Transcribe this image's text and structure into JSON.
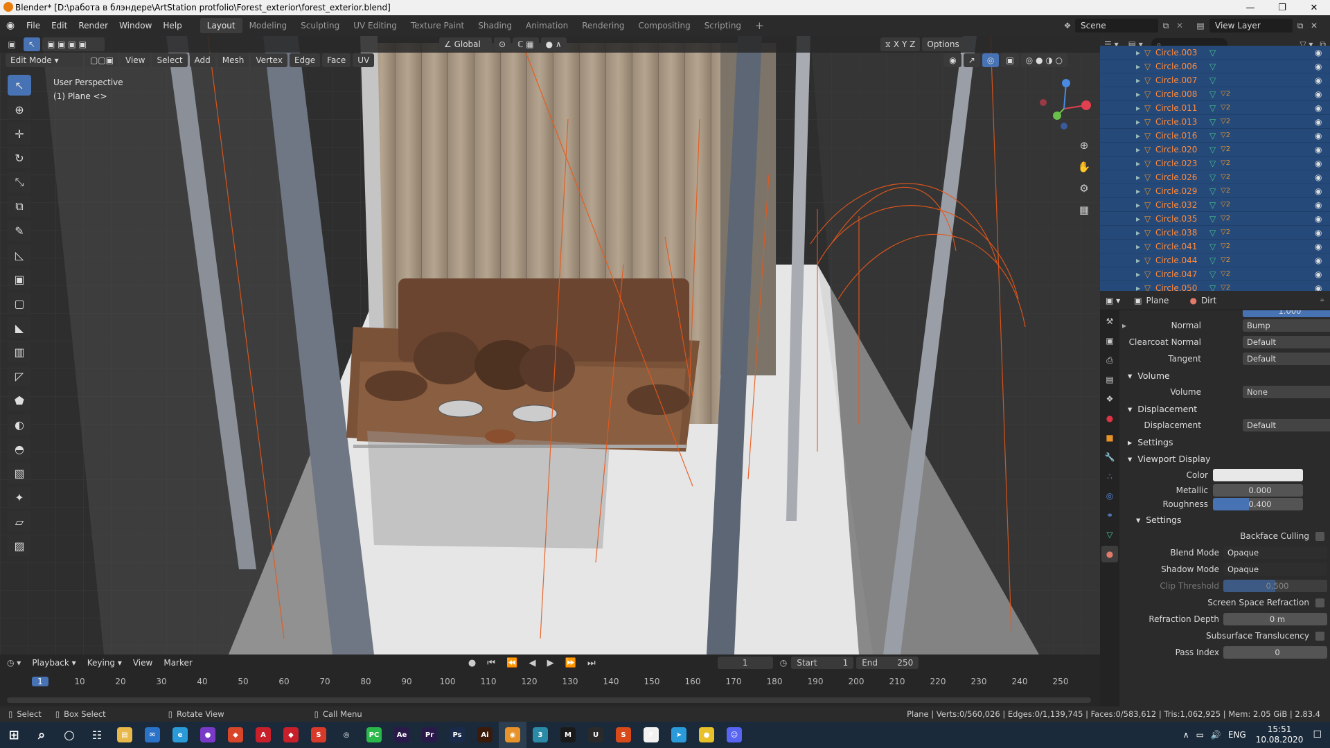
{
  "window": {
    "title": "Blender* [D:\\работа в блэндере\\ArtStation protfolio\\Forest_exterior\\forest_exterior.blend]"
  },
  "menus": [
    "File",
    "Edit",
    "Render",
    "Window",
    "Help"
  ],
  "workspaces": [
    "Layout",
    "Modeling",
    "Sculpting",
    "UV Editing",
    "Texture Paint",
    "Shading",
    "Animation",
    "Rendering",
    "Compositing",
    "Scripting"
  ],
  "scene": {
    "name": "Scene",
    "view_layer": "View Layer"
  },
  "viewport": {
    "mode": "Edit Mode",
    "header_menus": [
      "View",
      "Select",
      "Add",
      "Mesh",
      "Vertex",
      "Edge",
      "Face",
      "UV"
    ],
    "transform_orientation": "Global",
    "overlay_title": "User Perspective",
    "overlay_subtitle": "(1) Plane <>",
    "options_label": "Options",
    "axis_x": "X",
    "axis_y": "Y",
    "axis_z": "Z"
  },
  "outliner": {
    "items": [
      "Circle.003",
      "Circle.006",
      "Circle.007",
      "Circle.008",
      "Circle.011",
      "Circle.013",
      "Circle.016",
      "Circle.020",
      "Circle.023",
      "Circle.026",
      "Circle.029",
      "Circle.032",
      "Circle.035",
      "Circle.038",
      "Circle.041",
      "Circle.044",
      "Circle.047",
      "Circle.050"
    ],
    "badge": "2"
  },
  "properties": {
    "object": "Plane",
    "material": "Dirt",
    "alpha_partial": "1.000",
    "normal": {
      "label": "Normal",
      "value": "Bump"
    },
    "clearcoat_normal": {
      "label": "Clearcoat Normal",
      "value": "Default"
    },
    "tangent": {
      "label": "Tangent",
      "value": "Default"
    },
    "volume_section": "Volume",
    "volume": {
      "label": "Volume",
      "value": "None"
    },
    "displacement_section": "Displacement",
    "displacement": {
      "label": "Displacement",
      "value": "Default"
    },
    "settings_section": "Settings",
    "viewport_display_section": "Viewport Display",
    "color_label": "Color",
    "metallic": {
      "label": "Metallic",
      "value": "0.000",
      "level": 0.0
    },
    "roughness": {
      "label": "Roughness",
      "value": "0.400",
      "level": 0.4
    },
    "vd_settings": "Settings",
    "backface_culling": "Backface Culling",
    "blend_mode": {
      "label": "Blend Mode",
      "value": "Opaque"
    },
    "shadow_mode": {
      "label": "Shadow Mode",
      "value": "Opaque"
    },
    "clip_threshold": {
      "label": "Clip Threshold",
      "value": "0.500",
      "level": 0.5
    },
    "ssr": "Screen Space Refraction",
    "refraction_depth": {
      "label": "Refraction Depth",
      "value": "0 m"
    },
    "sss": "Subsurface Translucency",
    "pass_index": {
      "label": "Pass Index",
      "value": "0"
    }
  },
  "timeline": {
    "menus": [
      "Playback",
      "Keying",
      "View",
      "Marker"
    ],
    "current_frame": "1",
    "start_label": "Start",
    "start": "1",
    "end_label": "End",
    "end": "250",
    "ticks": [
      "1",
      "10",
      "20",
      "30",
      "40",
      "50",
      "60",
      "70",
      "80",
      "90",
      "100",
      "110",
      "120",
      "130",
      "140",
      "150",
      "160",
      "170",
      "180",
      "190",
      "200",
      "210",
      "220",
      "230",
      "240",
      "250"
    ]
  },
  "statusbar": {
    "select": "Select",
    "box_select": "Box Select",
    "rotate_view": "Rotate View",
    "call_menu": "Call Menu",
    "stats": "Plane | Verts:0/560,026 | Edges:0/1,139,745 | Faces:0/583,612 | Tris:1,062,925 | Mem: 2.05 GiB | 2.83.4"
  },
  "taskbar": {
    "apps": [
      "Explorer",
      "Mail",
      "Edge",
      "Tor",
      "Brave",
      "Acrobat",
      "Adobe",
      "Sketch",
      "Steam",
      "PyCharm",
      "After Effects",
      "Premiere",
      "Photoshop",
      "Illustrator",
      "Blender",
      "3ds Max",
      "MAXON",
      "Unity",
      "Substance",
      "Figma",
      "Telegram",
      "Chrome",
      "Discord"
    ],
    "lang": "ENG",
    "time": "15:51",
    "date": "10.08.2020"
  }
}
